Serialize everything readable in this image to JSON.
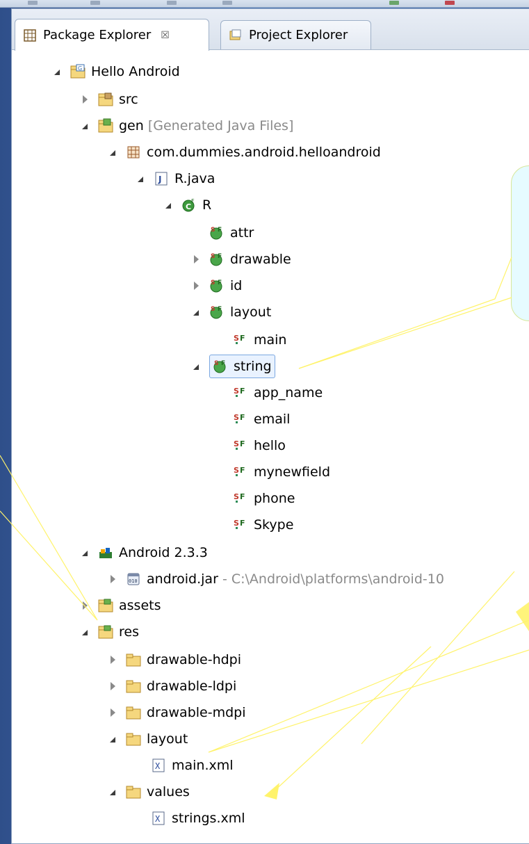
{
  "tabs": {
    "package_explorer": "Package Explorer",
    "package_close": "☒",
    "project_explorer": "Project Explorer"
  },
  "tree": {
    "project": "Hello Android",
    "src": "src",
    "gen": "gen",
    "gen_note": "[Generated Java Files]",
    "package": "com.dummies.android.helloandroid",
    "rjava": "R.java",
    "r_class": "R",
    "attr": "attr",
    "drawable": "drawable",
    "id": "id",
    "layout": "layout",
    "main": "main",
    "string": "string",
    "strings": [
      "app_name",
      "email",
      "hello",
      "mynewfield",
      "phone",
      "Skype"
    ],
    "android_lib": "Android 2.3.3",
    "android_jar": "android.jar",
    "android_jar_path": "- C:\\Android\\platforms\\android-10",
    "assets": "assets",
    "res": "res",
    "drawable_hdpi": "drawable-hdpi",
    "drawable_ldpi": "drawable-ldpi",
    "drawable_mdpi": "drawable-mdpi",
    "res_layout": "layout",
    "main_xml": "main.xml",
    "values": "values",
    "strings_xml": "strings.xml"
  },
  "colors": {
    "background": "#3a66a8",
    "callout": "#fff36b",
    "selection": "#e9f2ff"
  }
}
